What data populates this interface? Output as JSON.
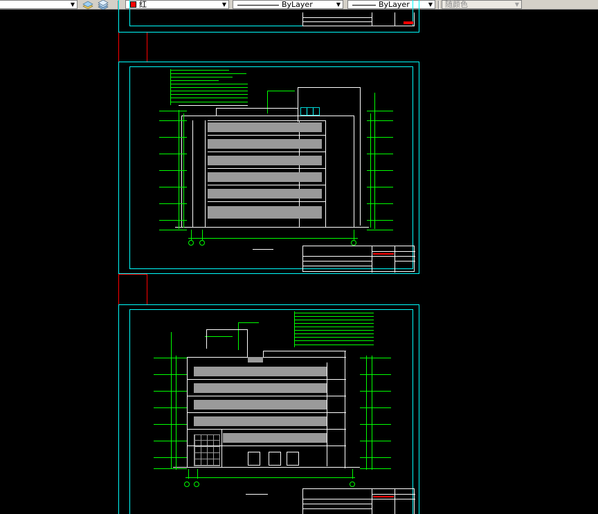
{
  "toolbar": {
    "color_value": "红",
    "color_swatch": "#ff0000",
    "linetype_value": "ByLayer",
    "lineweight_value": "ByLayer",
    "plotstyle_value": "随颜色"
  },
  "accent_colors": {
    "frame": "#00ffff",
    "dimension": "#00ff00",
    "viewport_border": "#ff0000",
    "background": "#000000"
  }
}
